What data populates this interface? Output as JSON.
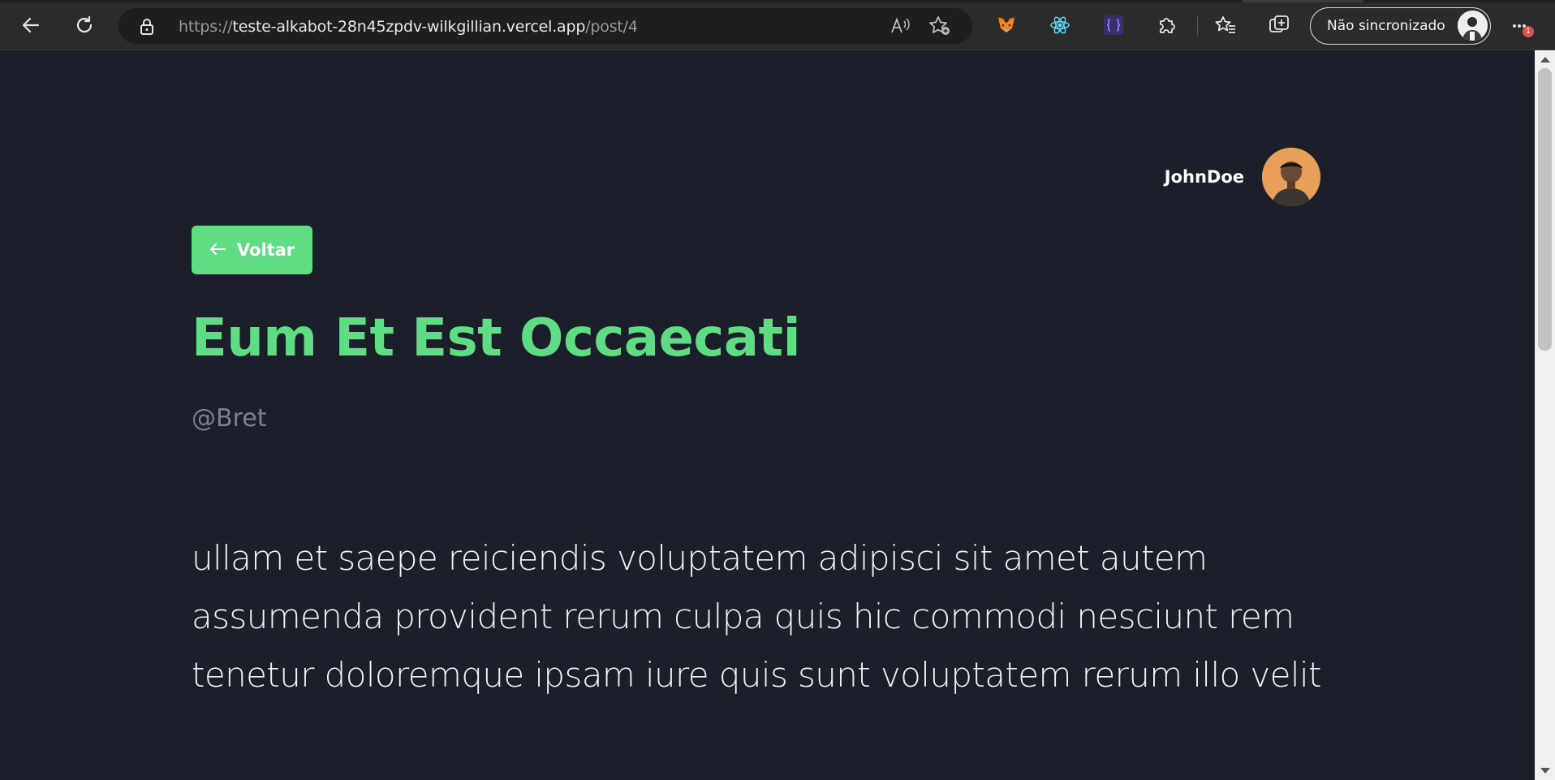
{
  "browser": {
    "url_scheme": "https://",
    "url_host": "teste-alkabot-28n45zpdv-wilkgillian.vercel.app",
    "url_path": "/post/4",
    "sync_label": "Não sincronizado",
    "alert_badge": "1",
    "icons": [
      "back-arrow-icon",
      "refresh-icon",
      "lock-icon",
      "read-aloud-icon",
      "add-favorite-icon",
      "metamask-extension-icon",
      "react-devtools-extension-icon",
      "json-extension-icon",
      "extensions-icon",
      "favorites-icon",
      "collections-icon",
      "more-icon"
    ]
  },
  "header": {
    "username": "JohnDoe"
  },
  "back_button": {
    "label": "Voltar"
  },
  "post": {
    "title": "Eum Et Est Occaecati",
    "author": "@Bret",
    "body_lines": [
      "ullam et saepe reiciendis voluptatem adipisci sit amet autem",
      "assumenda provident rerum culpa quis hic commodi nesciunt rem",
      "tenetur doloremque ipsam iure quis sunt voluptatem rerum illo velit"
    ]
  },
  "colors": {
    "background": "#1b1f29",
    "accent": "#60dd84",
    "author_text": "#7b8190"
  }
}
